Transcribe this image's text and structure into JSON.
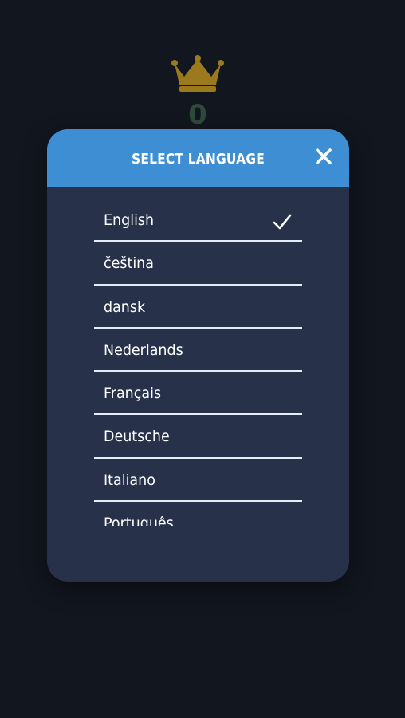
{
  "background": {
    "best_score": "0",
    "crown_icon": "crown-icon",
    "crown_color": "#9a7a1c",
    "bg_color": "#12161f"
  },
  "dialog": {
    "title": "SELECT LANGUAGE",
    "close_icon": "close-icon",
    "header_color": "#3d8ed3",
    "body_color": "#27314a",
    "selected": "English",
    "languages": [
      "English",
      "čeština",
      "dansk",
      "Nederlands",
      "Français",
      "Deutsche",
      "Italiano",
      "Português"
    ]
  }
}
